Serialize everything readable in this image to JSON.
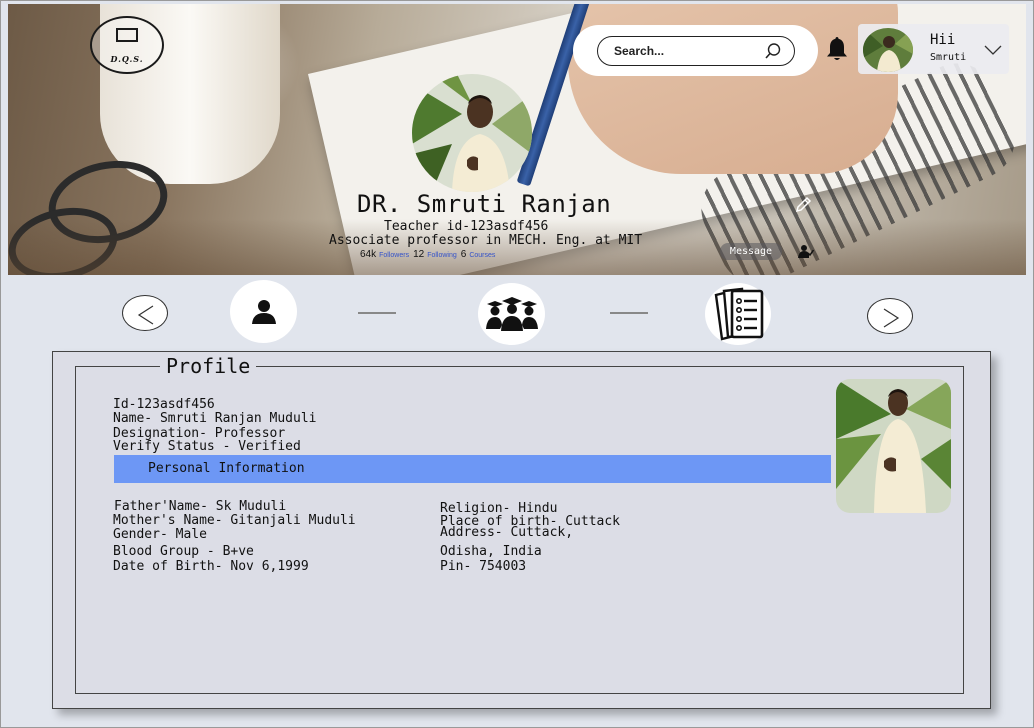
{
  "header": {
    "logo_text": "D.Q.S.",
    "search": {
      "placeholder": "Search..."
    },
    "user": {
      "greeting": "Hii",
      "name": "Smruti"
    }
  },
  "hero": {
    "name": "DR. Smruti Ranjan",
    "teacher_id": "Teacher id-123asdf456",
    "role": "Associate professor in MECH. Eng. at MIT",
    "stats": {
      "followers_count": "64k",
      "followers_label": "Followers",
      "following_count": "12",
      "following_label": "Following",
      "courses_count": "6",
      "courses_label": "Courses"
    },
    "message_label": "Message"
  },
  "steps": [
    {
      "icon": "user-icon"
    },
    {
      "icon": "students-icon"
    },
    {
      "icon": "documents-icon"
    }
  ],
  "profile": {
    "legend": "Profile",
    "id": "Id-123asdf456",
    "name": "Name- Smruti Ranjan Muduli",
    "designation": "Designation- Professor",
    "verify_status": "Verify Status - Verified",
    "section_title": "Personal Information",
    "left": {
      "father": "Father'Name- Sk Muduli",
      "mother": "Mother's Name- Gitanjali Muduli",
      "gender": "Gender- Male",
      "blood_group": "Blood Group - B+ve",
      "dob": "Date of Birth- Nov 6,1999"
    },
    "right": {
      "religion": "Religion- Hindu",
      "place_of_birth": "Place of birth- Cuttack",
      "address": "Address- Cuttack,",
      "address_line2": "Odisha, India",
      "pin": "Pin- 754003"
    }
  },
  "colors": {
    "section_bar": "#6d97f5",
    "link": "#3553c9",
    "card_bg": "#dcdde6"
  }
}
